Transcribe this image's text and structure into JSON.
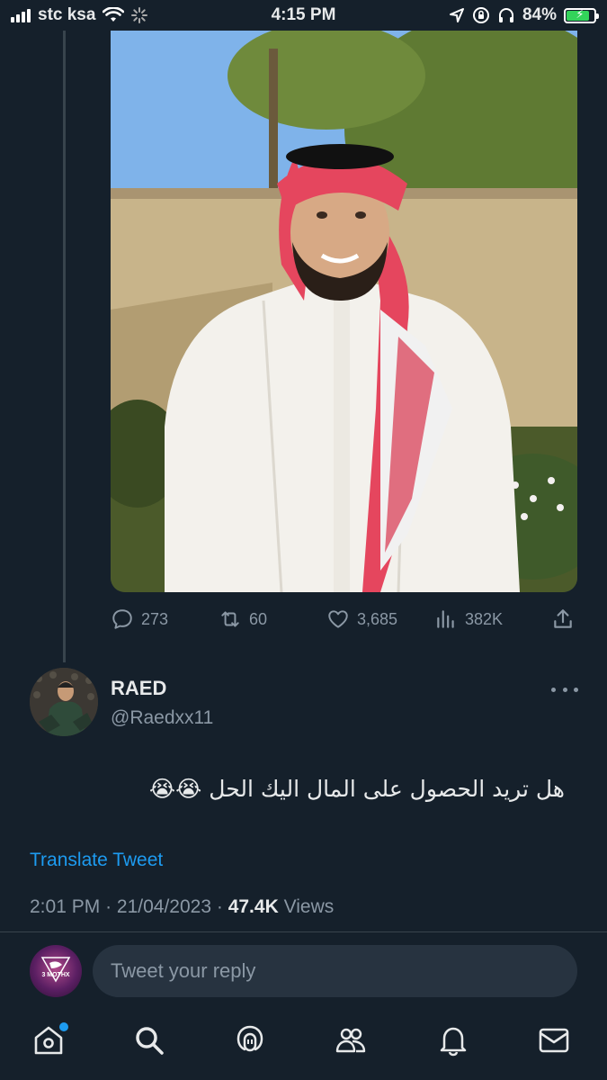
{
  "status_bar": {
    "carrier": "stc ksa",
    "time": "4:15 PM",
    "battery_percent": "84%",
    "battery_level": 0.84,
    "icons": [
      "signal-icon",
      "wifi-icon",
      "loading-icon",
      "location-icon",
      "orientation-lock-icon",
      "headphones-icon",
      "battery-charging-icon"
    ]
  },
  "tweet": {
    "photo_name": "photo-man-in-shemagh",
    "stats": {
      "replies": "273",
      "retweets": "60",
      "likes": "3,685",
      "views": "382K"
    }
  },
  "reply_tweet": {
    "author_name": "RAED",
    "author_handle": "@Raedxx11",
    "text": "هل تريد الحصول على المال اليك الحل 😭😭",
    "translate_label": "Translate Tweet",
    "time": "2:01 PM",
    "date": "21/04/2023",
    "views_count": "47.4K",
    "views_label": "Views",
    "separator": "·"
  },
  "reply_box": {
    "placeholder": "Tweet your reply",
    "avatar_text": "3 MOTHX"
  },
  "bottom_nav": {
    "items": [
      "home-icon",
      "search-icon",
      "spaces-icon",
      "communities-icon",
      "notifications-icon",
      "messages-icon"
    ]
  },
  "colors": {
    "background": "#15202b",
    "accent": "#1d9bf0",
    "muted": "#8b98a5",
    "text": "#e7e9ea"
  }
}
